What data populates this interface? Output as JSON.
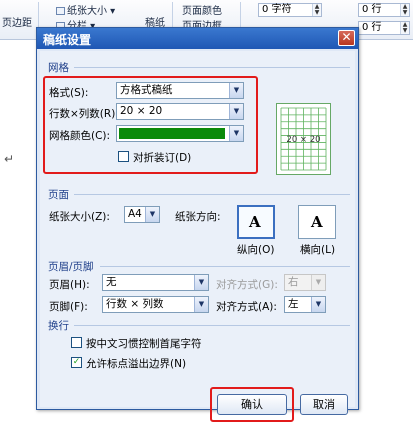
{
  "ribbon": {
    "page_margin": "页边距",
    "paper_size": "纸张大小",
    "columns": "分栏",
    "draft_paper": "稿纸",
    "page_color": "页面颜色",
    "page_border": "页面边框",
    "indent_value": "0 字符",
    "spacing_value_1": "0 行",
    "spacing_value_2": "0 行",
    "setup_group": "页面"
  },
  "dialog": {
    "title": "稿纸设置",
    "close_symbol": "✕",
    "grid": {
      "heading": "网格",
      "format_label": "格式(S):",
      "format_value": "方格式稿纸",
      "rowcol_label": "行数×列数(R):",
      "rowcol_value": "20 × 20",
      "color_label": "网格颜色(C):",
      "color_value": "#0a8a0a",
      "fold_label": "对折装订(D)",
      "fold_checked": false,
      "preview_text": "20 × 20",
      "preview_line_color": "#5fb35f"
    },
    "page": {
      "heading": "页面",
      "size_label": "纸张大小(Z):",
      "size_value": "A4",
      "orientation_label": "纸张方向:",
      "portrait_label": "纵向(O)",
      "landscape_label": "横向(L)",
      "glyph": "A"
    },
    "header_footer": {
      "heading": "页眉/页脚",
      "header_label": "页眉(H):",
      "header_value": "无",
      "header_align_label": "对齐方式(G):",
      "header_align_value": "右",
      "footer_label": "页脚(F):",
      "footer_value": "行数 × 列数",
      "footer_align_label": "对齐方式(A):",
      "footer_align_value": "左"
    },
    "wrap": {
      "heading": "换行",
      "option1_label": "按中文习惯控制首尾字符",
      "option1_checked": false,
      "option2_label": "允许标点溢出边界(N)",
      "option2_checked": true
    },
    "buttons": {
      "ok": "确认",
      "cancel": "取消"
    }
  }
}
